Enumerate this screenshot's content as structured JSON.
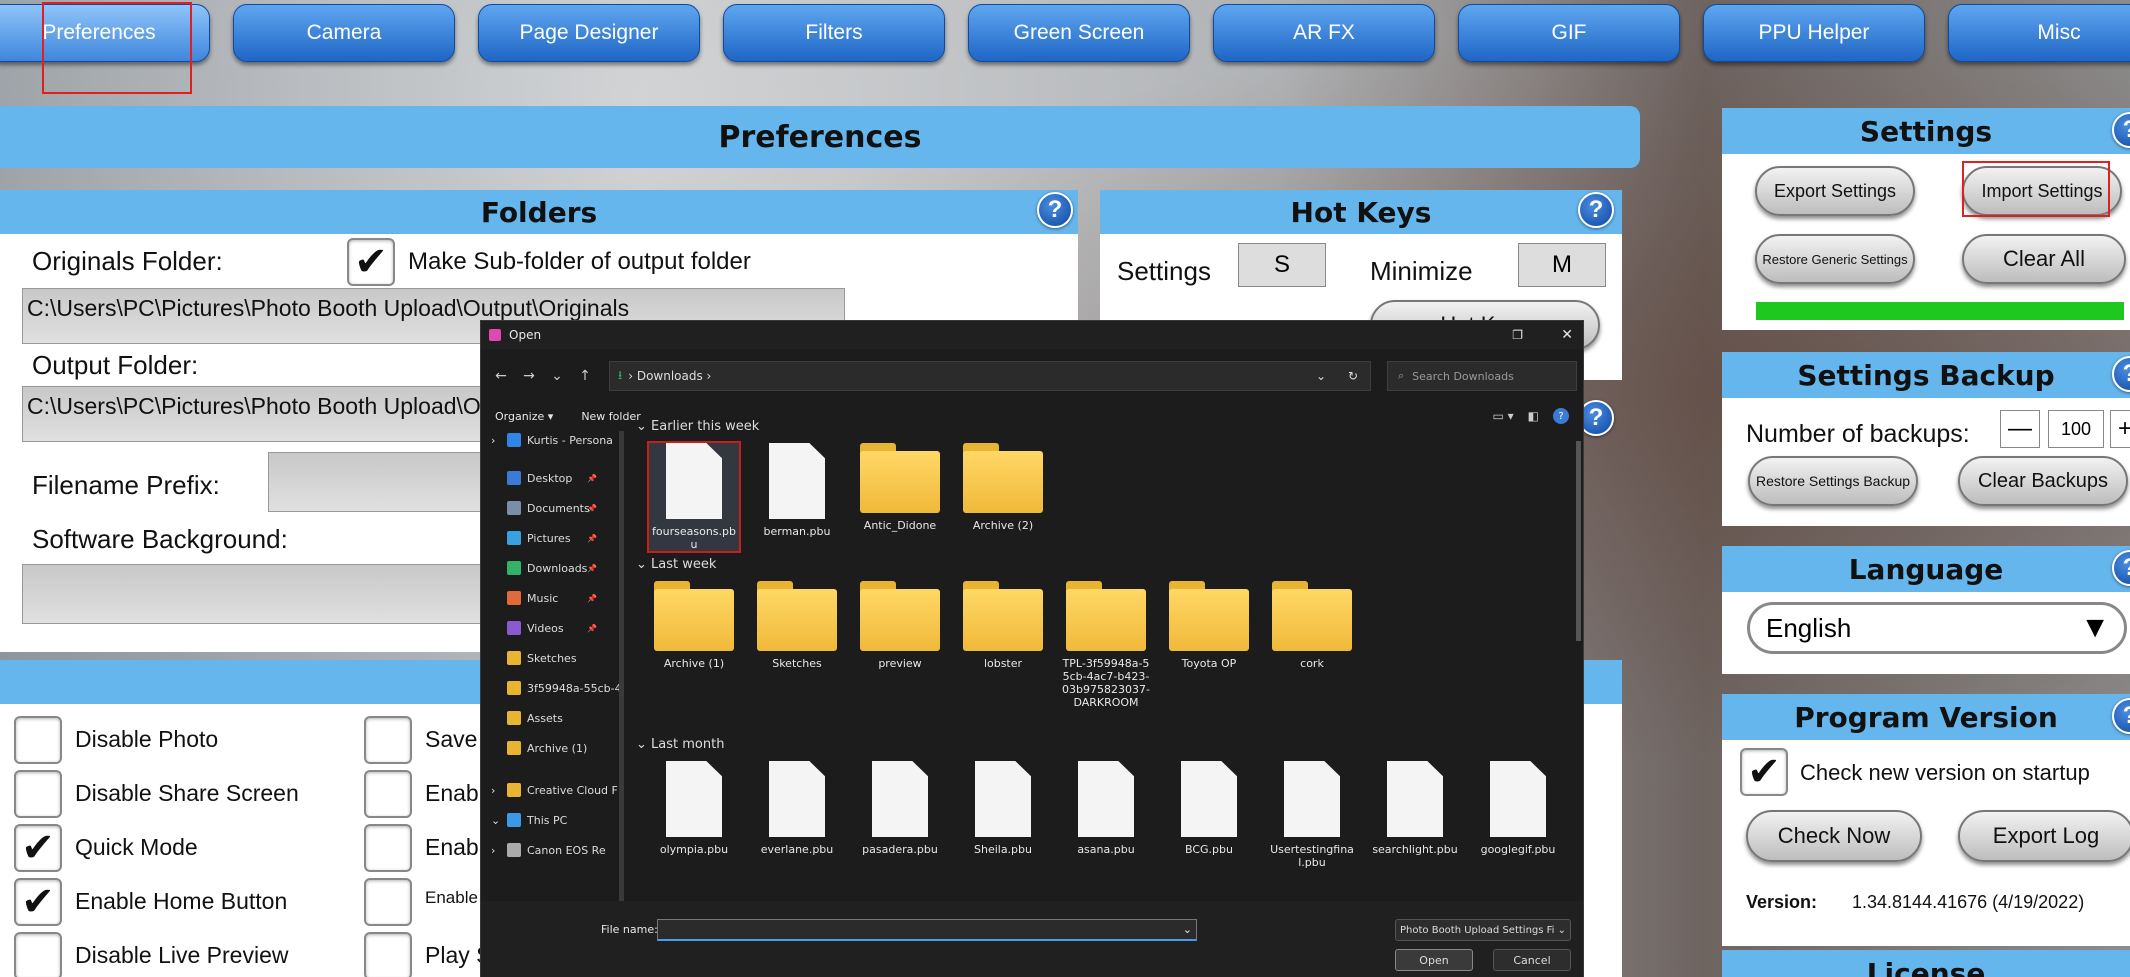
{
  "tabs": [
    "Preferences",
    "Camera",
    "Page Designer",
    "Filters",
    "Green Screen",
    "AR FX",
    "GIF",
    "PPU Helper",
    "Misc"
  ],
  "main_title": "Preferences",
  "folders": {
    "title": "Folders",
    "originals_label": "Originals Folder:",
    "subfolder_label": "Make Sub-folder of output folder",
    "originals_value": "C:\\Users\\PC\\Pictures\\Photo Booth Upload\\Output\\Originals",
    "output_label": "Output Folder:",
    "output_value": "C:\\Users\\PC\\Pictures\\Photo Booth Upload\\Output",
    "prefix_label": "Filename Prefix:",
    "bg_label": "Software Background:"
  },
  "hotkeys": {
    "title": "Hot Keys",
    "settings_label": "Settings",
    "settings_key": "S",
    "minimize_label": "Minimize",
    "minimize_key": "M",
    "hotkeys_button": "Hot Keys"
  },
  "options": {
    "col1": [
      "Disable Photo",
      "Disable Share Screen",
      "Quick Mode",
      "Enable Home Button",
      "Disable Live Preview"
    ],
    "col1_checked": [
      false,
      false,
      true,
      true,
      false
    ],
    "col2": [
      "Save",
      "Enabl",
      "Enabl",
      "Enable s",
      "Play S"
    ]
  },
  "settings": {
    "title": "Settings",
    "export": "Export Settings",
    "import": "Import Settings",
    "restore": "Restore Generic Settings",
    "clear": "Clear All",
    "progress": 1.0
  },
  "backup": {
    "title": "Settings Backup",
    "number_label": "Number of backups:",
    "number_value": "100",
    "minus": "—",
    "restore": "Restore Settings Backup",
    "clear": "Clear Backups"
  },
  "language": {
    "title": "Language",
    "value": "English"
  },
  "version": {
    "title": "Program Version",
    "check_label": "Check new version on startup",
    "check_now": "Check Now",
    "export_log": "Export Log",
    "version_label": "Version:",
    "version_value": "1.34.8144.41676 (4/19/2022)"
  },
  "license": {
    "title": "License"
  },
  "dialog": {
    "title": "Open",
    "path": "Downloads",
    "search_placeholder": "Search Downloads",
    "organize": "Organize",
    "new_folder": "New folder",
    "sidebar": [
      {
        "label": "Kurtis - Persona",
        "icon": "cloud-icon",
        "color": "#2f86e6"
      },
      {
        "label": "Desktop",
        "icon": "desktop-icon",
        "color": "#3a7bd5"
      },
      {
        "label": "Documents",
        "icon": "documents-icon",
        "color": "#7a8ea8"
      },
      {
        "label": "Pictures",
        "icon": "pictures-icon",
        "color": "#3aa0e0"
      },
      {
        "label": "Downloads",
        "icon": "downloads-icon",
        "color": "#33b36a"
      },
      {
        "label": "Music",
        "icon": "music-icon",
        "color": "#e06a3a"
      },
      {
        "label": "Videos",
        "icon": "videos-icon",
        "color": "#8a5ad0"
      },
      {
        "label": "Sketches",
        "icon": "folder-icon",
        "color": "#e8b431"
      },
      {
        "label": "3f59948a-55cb-4",
        "icon": "folder-icon",
        "color": "#e8b431"
      },
      {
        "label": "Assets",
        "icon": "folder-icon",
        "color": "#e8b431"
      },
      {
        "label": "Archive (1)",
        "icon": "folder-icon",
        "color": "#e8b431"
      },
      {
        "label": "Creative Cloud F",
        "icon": "cc-folder-icon",
        "color": "#e8b431"
      },
      {
        "label": "This PC",
        "icon": "pc-icon",
        "color": "#3a9ae8"
      },
      {
        "label": "Canon EOS Re",
        "icon": "camera-icon",
        "color": "#aaaaaa"
      }
    ],
    "groups": [
      "Earlier this week",
      "Last week",
      "Last month"
    ],
    "earlier": [
      {
        "name": "fourseasons.pbu",
        "type": "doc"
      },
      {
        "name": "berman.pbu",
        "type": "doc"
      },
      {
        "name": "Antic_Didone",
        "type": "folder"
      },
      {
        "name": "Archive (2)",
        "type": "folder"
      }
    ],
    "lastweek": [
      {
        "name": "Archive (1)",
        "type": "folder"
      },
      {
        "name": "Sketches",
        "type": "folder"
      },
      {
        "name": "preview",
        "type": "folder"
      },
      {
        "name": "lobster",
        "type": "folder"
      },
      {
        "name": "TPL-3f59948a-55cb-4ac7-b423-03b975823037-DARKROOM",
        "type": "folder"
      },
      {
        "name": "Toyota OP",
        "type": "folder"
      },
      {
        "name": "cork",
        "type": "folder"
      }
    ],
    "lastmonth": [
      {
        "name": "olympia.pbu",
        "type": "doc"
      },
      {
        "name": "everlane.pbu",
        "type": "doc"
      },
      {
        "name": "pasadera.pbu",
        "type": "doc"
      },
      {
        "name": "Sheila.pbu",
        "type": "doc"
      },
      {
        "name": "asana.pbu",
        "type": "doc"
      },
      {
        "name": "BCG.pbu",
        "type": "doc"
      },
      {
        "name": "Usertestingfinal.pbu",
        "type": "doc"
      },
      {
        "name": "searchlight.pbu",
        "type": "doc"
      },
      {
        "name": "googlegif.pbu",
        "type": "doc"
      }
    ],
    "filename_label": "File name:",
    "filetype": "Photo Booth Upload Settings Fi",
    "open": "Open",
    "cancel": "Cancel"
  }
}
